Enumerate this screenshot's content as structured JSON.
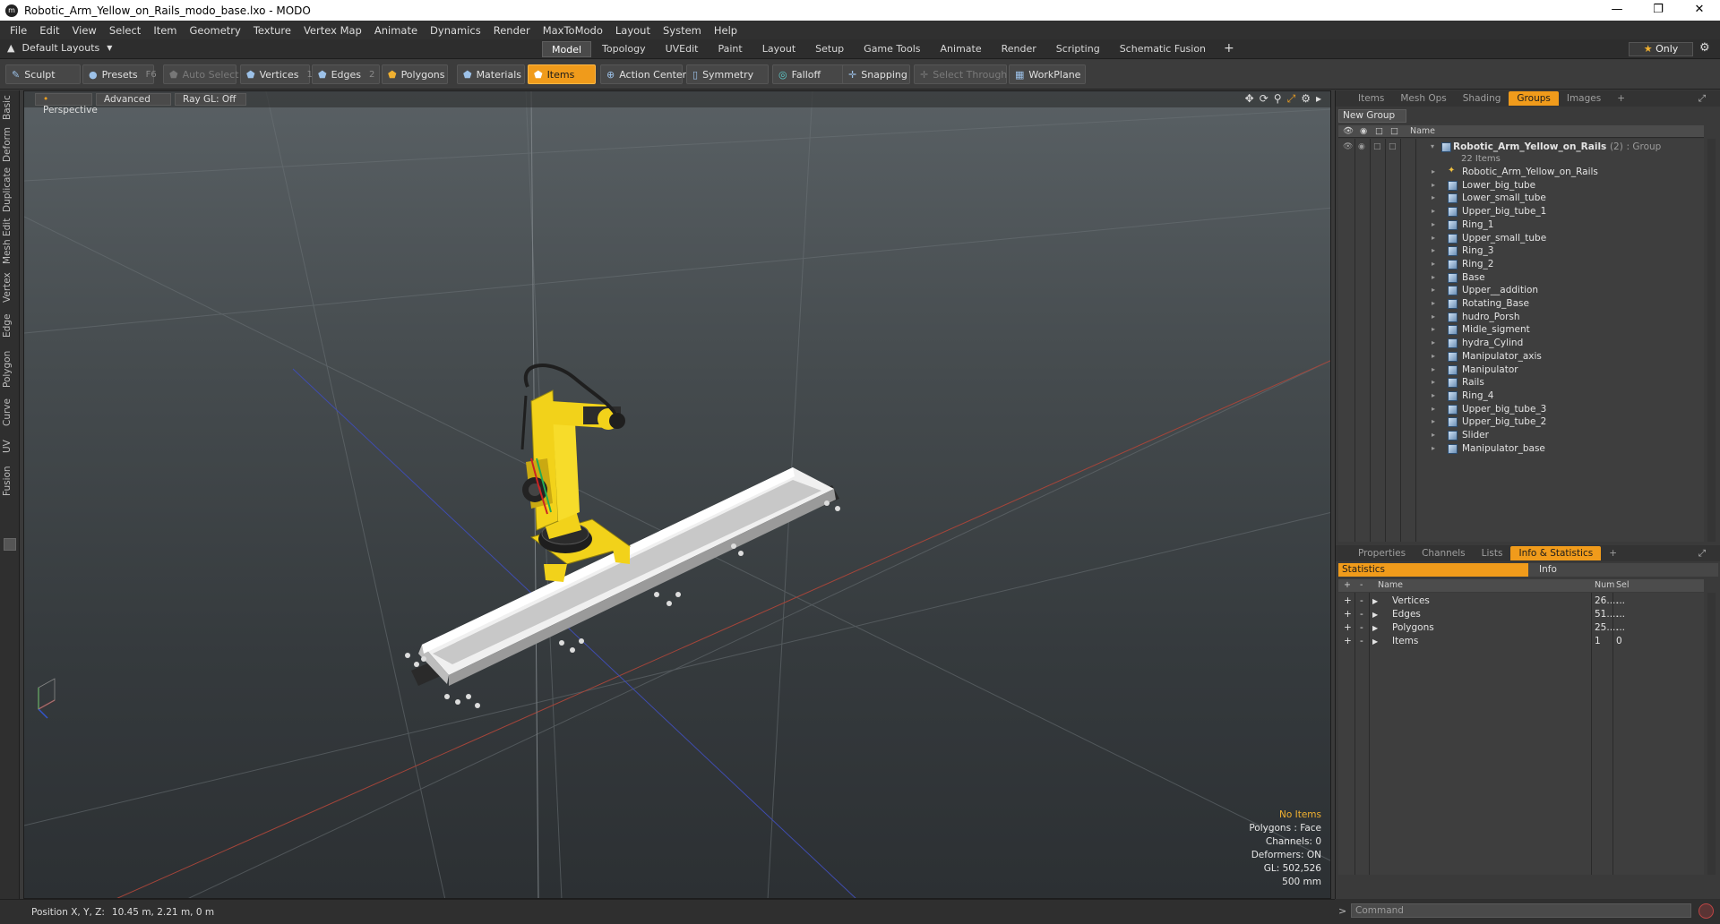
{
  "window": {
    "title": "Robotic_Arm_Yellow_on_Rails_modo_base.lxo - MODO",
    "logo": "modo-logo-icon",
    "controls": [
      "minimize-icon",
      "maximize-icon",
      "close-icon"
    ]
  },
  "menu": [
    "File",
    "Edit",
    "View",
    "Select",
    "Item",
    "Geometry",
    "Texture",
    "Vertex Map",
    "Animate",
    "Dynamics",
    "Render",
    "MaxToModo",
    "Layout",
    "System",
    "Help"
  ],
  "layoutbar": {
    "layouts_label": "Default Layouts",
    "tabs": [
      "Model",
      "Topology",
      "UVEdit",
      "Paint",
      "Layout",
      "Setup",
      "Game Tools",
      "Animate",
      "Render",
      "Scripting",
      "Schematic Fusion"
    ],
    "active_tab": "Model",
    "only_label": "Only"
  },
  "toolbar": {
    "sculpt": "Sculpt",
    "presets": "Presets",
    "presets_key": "F6",
    "auto_select": "Auto Select",
    "vertices": "Vertices",
    "vertices_key": "1",
    "edges": "Edges",
    "edges_key": "2",
    "polygons": "Polygons",
    "materials": "Materials",
    "items": "Items",
    "action_center": "Action Center",
    "symmetry": "Symmetry",
    "falloff": "Falloff",
    "snapping": "Snapping",
    "select_through": "Select Through",
    "workplane": "WorkPlane"
  },
  "left_tabs": [
    "Basic",
    "Deform",
    "Duplicate",
    "Mesh Edit",
    "Vertex",
    "Edge",
    "Polygon",
    "Curve",
    "UV",
    "Fusion"
  ],
  "viewport": {
    "view_mode": "Perspective",
    "shading": "Advanced",
    "raygl": "Ray GL: Off",
    "info": {
      "selection": "No Items",
      "polygons": "Polygons : Face",
      "channels": "Channels: 0",
      "deformers": "Deformers: ON",
      "gl": "GL: 502,526",
      "scale": "500 mm"
    }
  },
  "groups_panel": {
    "tabs": [
      "Items",
      "Mesh Ops",
      "Shading",
      "Groups",
      "Images"
    ],
    "active_tab": "Groups",
    "new_group": "New Group",
    "name_header": "Name",
    "root": {
      "name": "Robotic_Arm_Yellow_on_Rails",
      "count": "(2)",
      "kind": ": Group",
      "sub": "22 Items"
    },
    "items": [
      "Robotic_Arm_Yellow_on_Rails",
      "Lower_big_tube",
      "Lower_small_tube",
      "Upper_big_tube_1",
      "Ring_1",
      "Upper_small_tube",
      "Ring_3",
      "Ring_2",
      "Base",
      "Upper__addition",
      "Rotating_Base",
      "hudro_Porsh",
      "Midle_sigment",
      "hydra_Cylind",
      "Manipulator_axis",
      "Manipulator",
      "Rails",
      "Ring_4",
      "Upper_big_tube_3",
      "Upper_big_tube_2",
      "Slider",
      "Manipulator_base"
    ]
  },
  "stats_panel": {
    "tabs": [
      "Properties",
      "Channels",
      "Lists",
      "Info & Statistics"
    ],
    "active_tab": "Info & Statistics",
    "subtabs": {
      "statistics": "Statistics",
      "info": "Info"
    },
    "headers": {
      "name": "Name",
      "num": "Num",
      "sel": "Sel"
    },
    "rows": [
      {
        "name": "Vertices",
        "num": "26....",
        "sel": "..."
      },
      {
        "name": "Edges",
        "num": "51....",
        "sel": "..."
      },
      {
        "name": "Polygons",
        "num": "25....",
        "sel": "..."
      },
      {
        "name": "Items",
        "num": "1",
        "sel": "0"
      }
    ]
  },
  "command": {
    "placeholder": "Command"
  },
  "status": {
    "label": "Position X, Y, Z:",
    "value": "10.45 m, 2.21 m, 0 m"
  },
  "colors": {
    "accent": "#f09b1b",
    "robot_yellow": "#f2d21a",
    "rail_white": "#e6e6e6"
  }
}
